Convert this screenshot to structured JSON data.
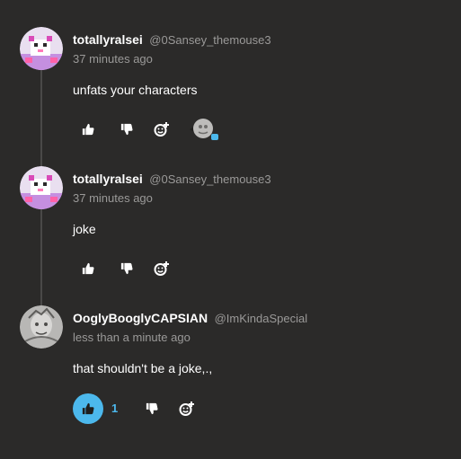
{
  "colors": {
    "background": "#2b2a29",
    "text_primary": "#ffffff",
    "text_secondary": "#9a9998",
    "accent": "#4cb8ec",
    "thread_line": "#4a4948"
  },
  "comments": [
    {
      "username": "totallyralsei",
      "handle": "@0Sansey_themouse3",
      "timestamp": "37 minutes ago",
      "text": "unfats your characters",
      "avatar_icon": "pixel-goat-avatar-icon",
      "actions": {
        "like_icon": "thumbs-up-icon",
        "dislike_icon": "thumbs-down-icon",
        "react_icon": "add-reaction-icon"
      },
      "reaction_icon": "user-reaction-avatar-icon"
    },
    {
      "username": "totallyralsei",
      "handle": "@0Sansey_themouse3",
      "timestamp": "37 minutes ago",
      "text": "joke",
      "avatar_icon": "pixel-goat-avatar-icon",
      "actions": {
        "like_icon": "thumbs-up-icon",
        "dislike_icon": "thumbs-down-icon",
        "react_icon": "add-reaction-icon"
      }
    },
    {
      "username": "OoglyBooglyCAPSIAN",
      "handle": "@ImKindaSpecial",
      "timestamp": "less than a minute ago",
      "text": "that shouldn't be a joke,.,",
      "avatar_icon": "sketch-portrait-avatar-icon",
      "like_count": "1",
      "liked": true,
      "actions": {
        "like_icon": "thumbs-up-icon",
        "dislike_icon": "thumbs-down-icon",
        "react_icon": "add-reaction-icon"
      }
    }
  ]
}
